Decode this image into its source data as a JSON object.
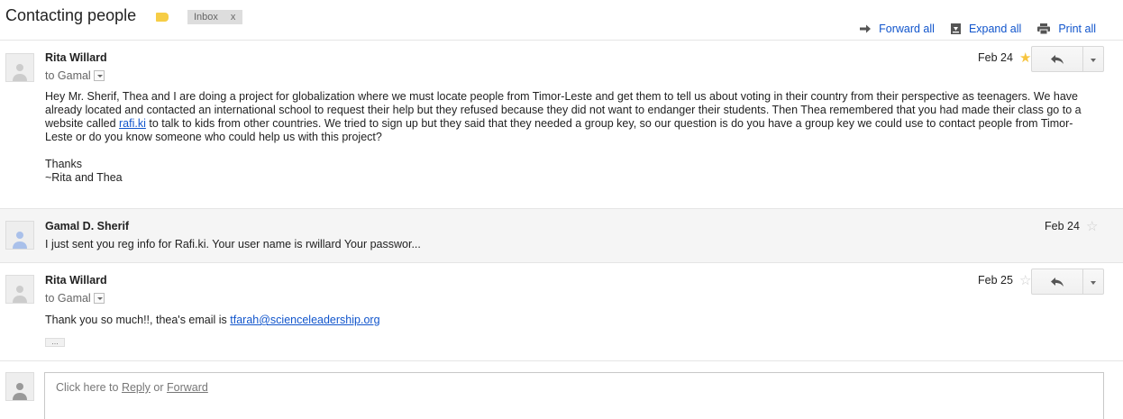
{
  "thread": {
    "subject": "Contacting people",
    "label_color": "#f6cd46",
    "inbox_chip": "Inbox",
    "inbox_chip_close": "x"
  },
  "actions": {
    "forward_all": "Forward all",
    "expand_all": "Expand all",
    "print_all": "Print all"
  },
  "messages": [
    {
      "sender": "Rita Willard",
      "to": "to Gamal",
      "date": "Feb 24",
      "starred": true,
      "body_p1_before": "Hey Mr. Sherif, Thea and I are doing a project for globalization where we must locate people from Timor-Leste and get them to tell us about voting in their country from their perspective as teenagers. We have already located and contacted an international school to request their help but they refused because they did not want to endanger their students. Then Thea remembered that you had made their class go to a website called ",
      "body_p1_link": "rafi.ki",
      "body_p1_after": " to talk to kids from other countries. We tried to sign up but they said that they needed a group key, so our question is do you have a group key we could use to contact people from Timor-Leste or do you know someone who could help us with this project?",
      "body_thanks": "Thanks",
      "body_signoff": "~Rita and Thea"
    },
    {
      "sender": "Gamal D. Sherif",
      "date": "Feb 24",
      "starred": false,
      "snippet": "I just sent you reg info for Rafi.ki. Your user name is rwillard Your passwor..."
    },
    {
      "sender": "Rita Willard",
      "to": "to Gamal",
      "date": "Feb 25",
      "starred": false,
      "body_before": "Thank you so much!!, thea's email is ",
      "body_link": "tfarah@scienceleadership.org",
      "ellipsis": "..."
    }
  ],
  "reply": {
    "prefix": "Click here to ",
    "reply_link": "Reply",
    "middle": " or ",
    "forward_link": "Forward"
  },
  "colors": {
    "link": "#1155cc",
    "star_on": "#f7c53f"
  }
}
